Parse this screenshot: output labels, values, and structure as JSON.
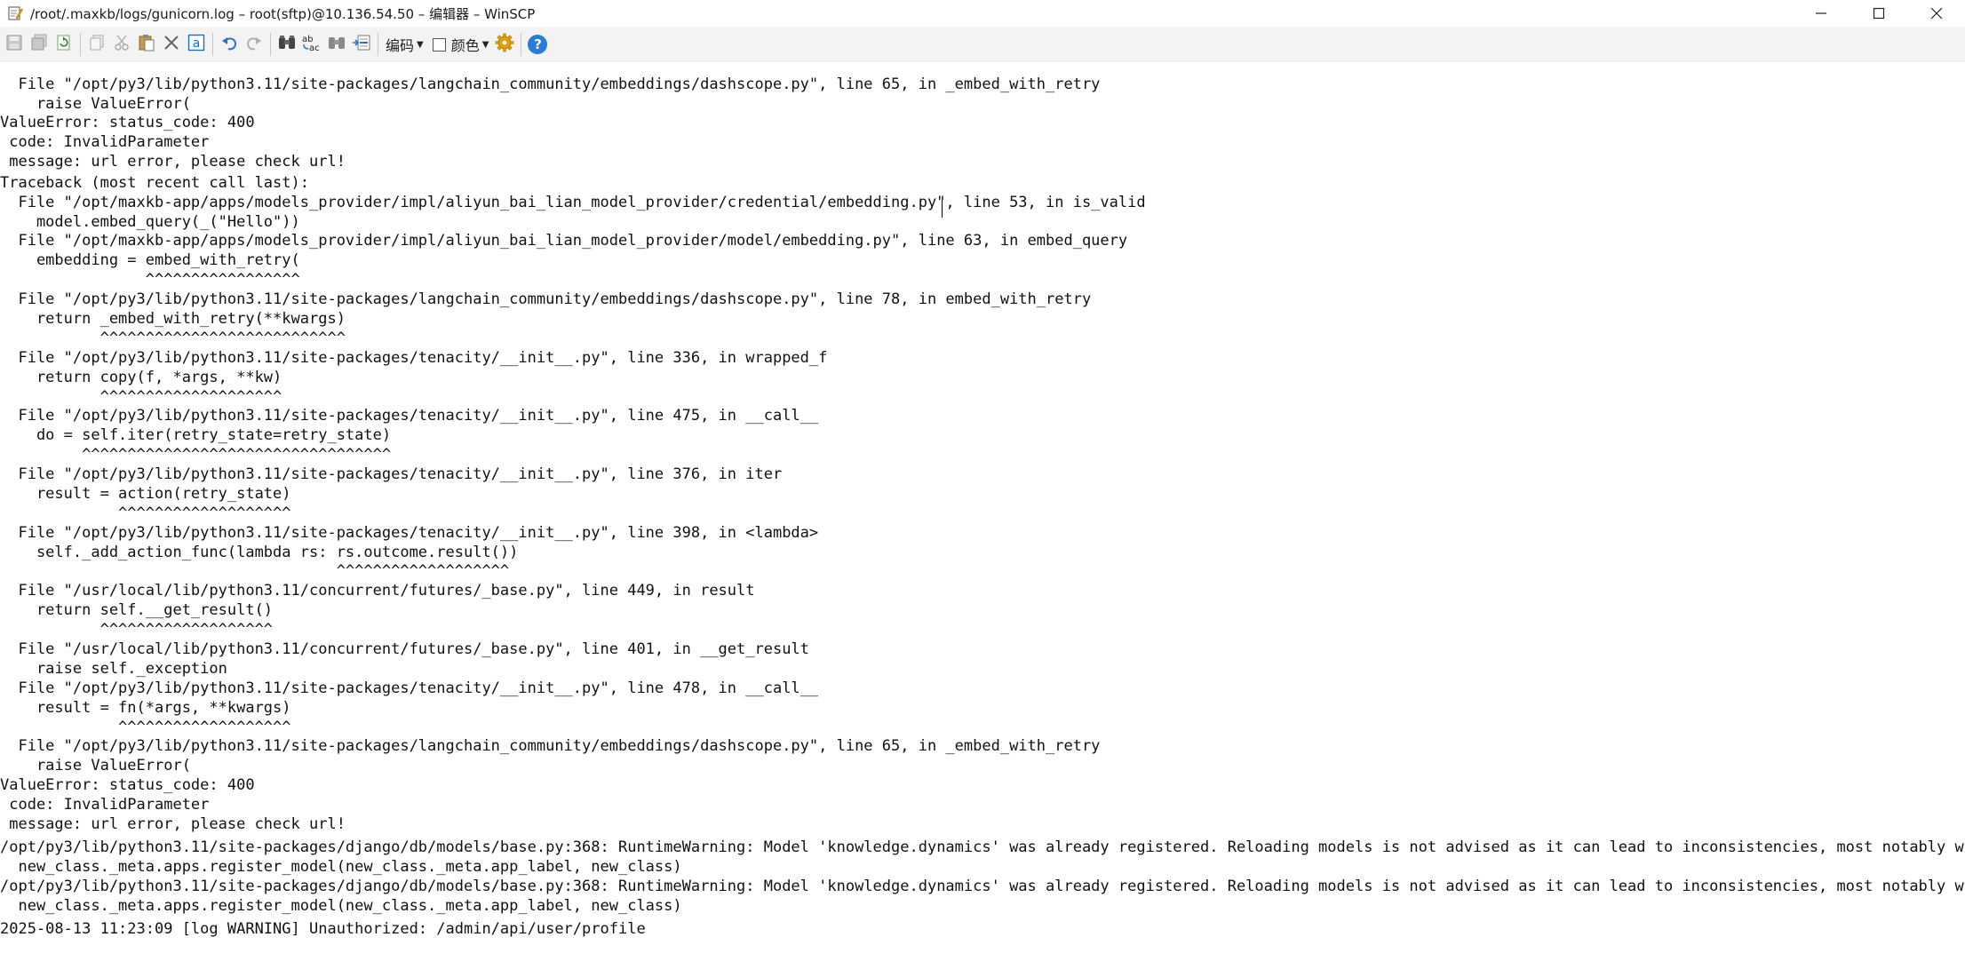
{
  "window": {
    "title": "/root/.maxkb/logs/gunicorn.log – root(sftp)@10.136.54.50 – 编辑器 – WinSCP",
    "minimize": "—",
    "maximize": "☐",
    "close": "✕"
  },
  "toolbar": {
    "encoding_label": "编码",
    "color_label": "颜色",
    "help_glyph": "?"
  },
  "editor": {
    "lines": [
      "  File \"/opt/py3/lib/python3.11/site-packages/langchain_community/embeddings/dashscope.py\", line 65, in _embed_with_retry",
      "    raise ValueError(",
      "ValueError: status_code: 400",
      " code: InvalidParameter",
      " message: url error, please check url!",
      "Traceback (most recent call last):",
      "  File \"/opt/maxkb-app/apps/models_provider/impl/aliyun_bai_lian_model_provider/credential/embedding.py\", line 53, in is_valid",
      "    model.embed_query(_(\"Hello\"))",
      "  File \"/opt/maxkb-app/apps/models_provider/impl/aliyun_bai_lian_model_provider/model/embedding.py\", line 63, in embed_query",
      "    embedding = embed_with_retry(",
      "                ^^^^^^^^^^^^^^^^^",
      "  File \"/opt/py3/lib/python3.11/site-packages/langchain_community/embeddings/dashscope.py\", line 78, in embed_with_retry",
      "    return _embed_with_retry(**kwargs)",
      "           ^^^^^^^^^^^^^^^^^^^^^^^^^^^",
      "  File \"/opt/py3/lib/python3.11/site-packages/tenacity/__init__.py\", line 336, in wrapped_f",
      "    return copy(f, *args, **kw)",
      "           ^^^^^^^^^^^^^^^^^^^^",
      "  File \"/opt/py3/lib/python3.11/site-packages/tenacity/__init__.py\", line 475, in __call__",
      "    do = self.iter(retry_state=retry_state)",
      "         ^^^^^^^^^^^^^^^^^^^^^^^^^^^^^^^^^^",
      "  File \"/opt/py3/lib/python3.11/site-packages/tenacity/__init__.py\", line 376, in iter",
      "    result = action(retry_state)",
      "             ^^^^^^^^^^^^^^^^^^^",
      "  File \"/opt/py3/lib/python3.11/site-packages/tenacity/__init__.py\", line 398, in <lambda>",
      "    self._add_action_func(lambda rs: rs.outcome.result())",
      "                                     ^^^^^^^^^^^^^^^^^^^",
      "  File \"/usr/local/lib/python3.11/concurrent/futures/_base.py\", line 449, in result",
      "    return self.__get_result()",
      "           ^^^^^^^^^^^^^^^^^^^",
      "  File \"/usr/local/lib/python3.11/concurrent/futures/_base.py\", line 401, in __get_result",
      "    raise self._exception",
      "  File \"/opt/py3/lib/python3.11/site-packages/tenacity/__init__.py\", line 478, in __call__",
      "    result = fn(*args, **kwargs)",
      "             ^^^^^^^^^^^^^^^^^^^",
      "  File \"/opt/py3/lib/python3.11/site-packages/langchain_community/embeddings/dashscope.py\", line 65, in _embed_with_retry",
      "    raise ValueError(",
      "ValueError: status_code: 400",
      " code: InvalidParameter",
      " message: url error, please check url!",
      "/opt/py3/lib/python3.11/site-packages/django/db/models/base.py:368: RuntimeWarning: Model 'knowledge.dynamics' was already registered. Reloading models is not advised as it can lead to inconsistencies, most notably with re",
      "  new_class._meta.apps.register_model(new_class._meta.app_label, new_class)",
      "/opt/py3/lib/python3.11/site-packages/django/db/models/base.py:368: RuntimeWarning: Model 'knowledge.dynamics' was already registered. Reloading models is not advised as it can lead to inconsistencies, most notably with re",
      "  new_class._meta.apps.register_model(new_class._meta.app_label, new_class)",
      "2025-08-13 11:23:09 [log WARNING] Unauthorized: /admin/api/user/profile"
    ]
  }
}
